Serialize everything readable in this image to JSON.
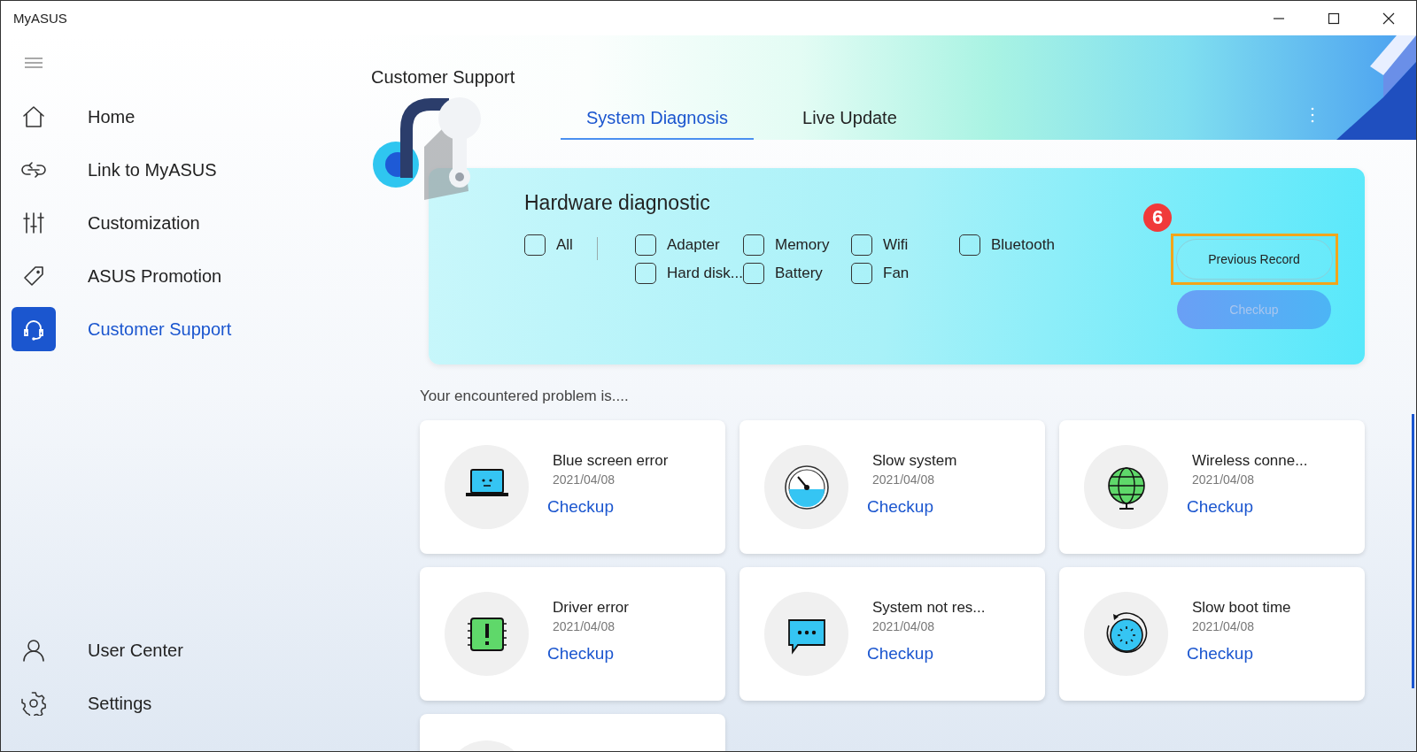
{
  "window": {
    "title": "MyASUS"
  },
  "sidebar": {
    "items": [
      {
        "label": "Home",
        "selected": false
      },
      {
        "label": "Link to MyASUS",
        "selected": false
      },
      {
        "label": "Customization",
        "selected": false
      },
      {
        "label": "ASUS Promotion",
        "selected": false
      },
      {
        "label": "Customer Support",
        "selected": true
      }
    ],
    "bottom_items": [
      {
        "label": "User Center",
        "selected": false
      },
      {
        "label": "Settings",
        "selected": false
      }
    ]
  },
  "page_title": "Customer Support",
  "tabs": [
    {
      "label": "System Diagnosis",
      "selected": true
    },
    {
      "label": "Live Update",
      "selected": false
    }
  ],
  "hardware": {
    "title": "Hardware diagnostic",
    "all": {
      "label": "All",
      "checked": false
    },
    "options": [
      {
        "label": "Adapter",
        "checked": false
      },
      {
        "label": "Memory",
        "checked": false
      },
      {
        "label": "Wifi",
        "checked": false
      },
      {
        "label": "Bluetooth",
        "checked": false
      },
      {
        "label": "Hard disk...",
        "checked": false
      },
      {
        "label": "Battery",
        "checked": false
      },
      {
        "label": "Fan",
        "checked": false
      }
    ],
    "step_badge": "6",
    "previous_record": {
      "label": "Previous Record",
      "highlighted": true
    },
    "checkup": {
      "label": "Checkup",
      "disabled": true
    }
  },
  "problems_heading": "Your encountered problem is....",
  "problems": [
    {
      "title": "Blue screen error",
      "date": "2021/04/08",
      "action": "Checkup"
    },
    {
      "title": "Slow system",
      "date": "2021/04/08",
      "action": "Checkup"
    },
    {
      "title": "Wireless conne...",
      "date": "2021/04/08",
      "action": "Checkup"
    },
    {
      "title": "Driver error",
      "date": "2021/04/08",
      "action": "Checkup"
    },
    {
      "title": "System not res...",
      "date": "2021/04/08",
      "action": "Checkup"
    },
    {
      "title": "Slow boot time",
      "date": "2021/04/08",
      "action": "Checkup"
    }
  ]
}
